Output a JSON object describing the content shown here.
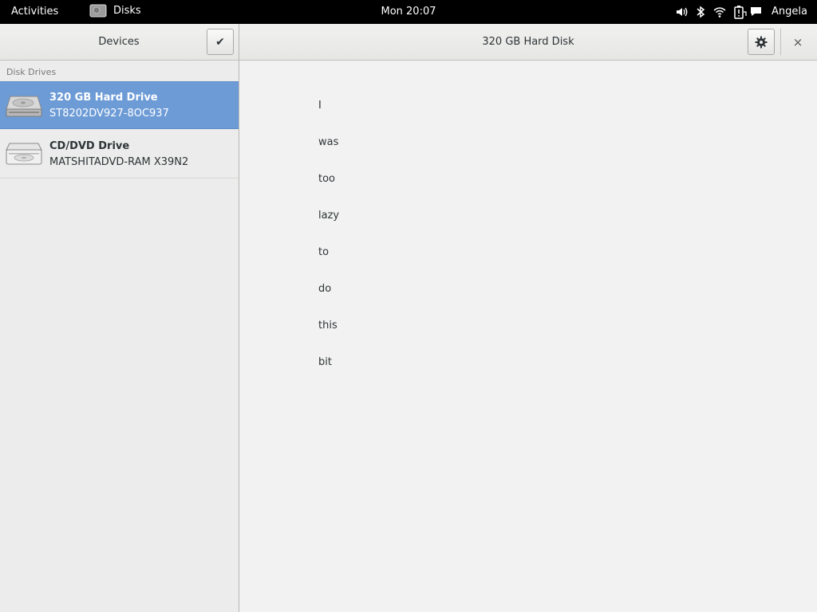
{
  "topbar": {
    "activities": "Activities",
    "app_name": "Disks",
    "clock": "Mon 20:07",
    "user": "Angela"
  },
  "left_pane": {
    "title": "Devices",
    "section": "Disk Drives",
    "drives": [
      {
        "name": "320 GB Hard Drive",
        "model": "ST8202DV927-8OC937"
      },
      {
        "name": "CD/DVD Drive",
        "model": "MATSHITADVD-RAM X39N2"
      }
    ]
  },
  "right_pane": {
    "title": "320 GB Hard Disk",
    "close_glyph": "×",
    "words": [
      "I",
      "was",
      "too",
      "lazy",
      "to",
      "do",
      "this",
      "bit"
    ]
  },
  "colors": {
    "selection": "#6d9bd6",
    "topbar": "#000000"
  }
}
